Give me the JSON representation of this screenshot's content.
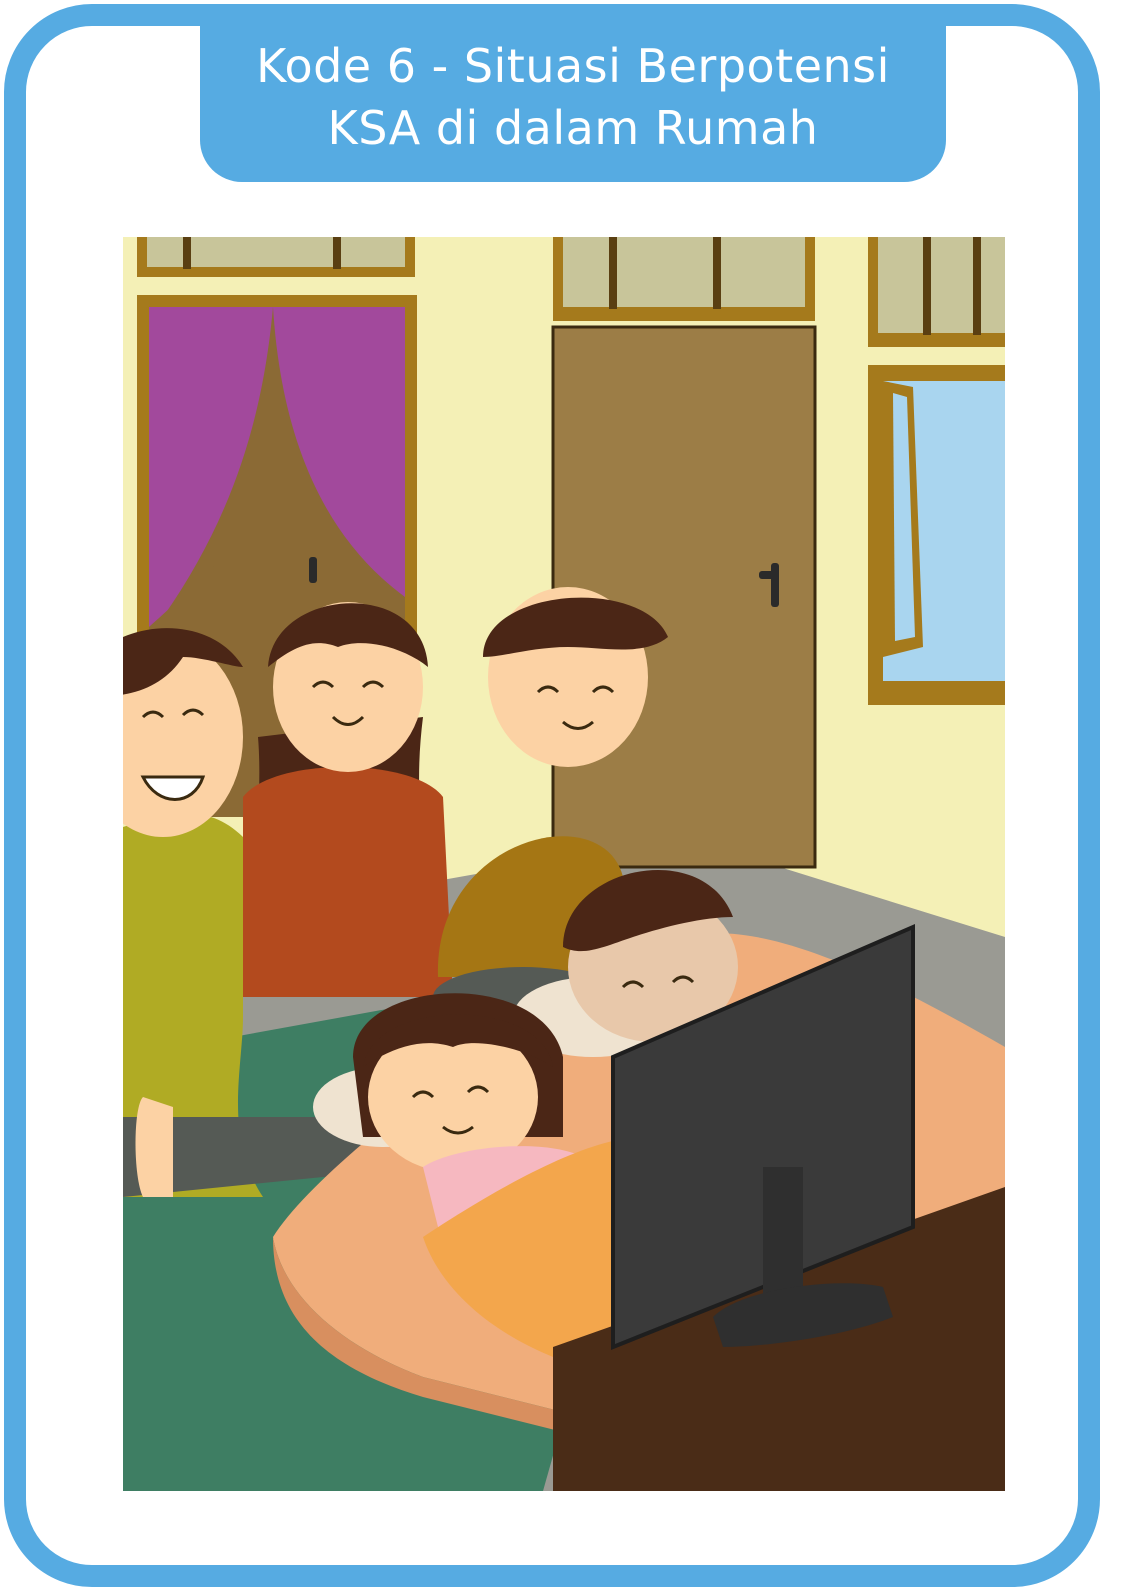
{
  "card": {
    "title_line_1": "Kode 6 - Situasi Berpotensi",
    "title_line_2": "KSA di dalam Rumah"
  },
  "illustration": {
    "subject": "family-watching-tv-illustration"
  },
  "colors": {
    "frame": "#56abe2",
    "wall": "#f4f0b6",
    "window_frame": "#a57a1c",
    "curtain": "#a2499c",
    "door": "#9c7d46",
    "mat": "#3e7e63",
    "mattress": "#f0ad7b",
    "blanket": "#f3a64c",
    "tv": "#3a3a3a",
    "tv_stand": "#4a2c17"
  }
}
